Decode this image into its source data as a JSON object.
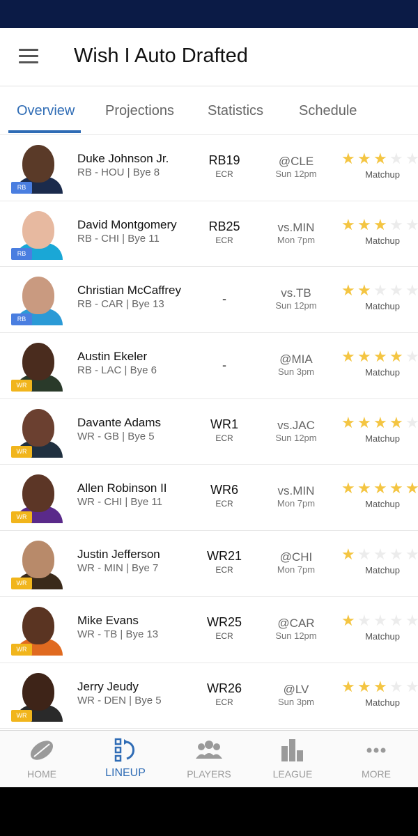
{
  "app": {
    "title": "Wish I Auto Drafted"
  },
  "tabs": [
    {
      "label": "Overview"
    },
    {
      "label": "Projections"
    },
    {
      "label": "Statistics"
    },
    {
      "label": "Schedule"
    }
  ],
  "colors": {
    "accent": "#2f6cb5",
    "rb_badge": "#4a7ee0",
    "wr_badge": "#f1b51c",
    "star": "#f4c542",
    "status_bar": "#0b1b46"
  },
  "players": [
    {
      "name": "Duke Johnson Jr.",
      "info": "RB - HOU | Bye 8",
      "badge": "RB",
      "rank": "RB19",
      "rank_label": "ECR",
      "opponent": "@CLE",
      "time": "Sun 12pm",
      "stars": 3,
      "matchup_label": "Matchup",
      "skin": "#5a3a28",
      "jersey": "#1b2b4c"
    },
    {
      "name": "David Montgomery",
      "info": "RB - CHI | Bye 11",
      "badge": "RB",
      "rank": "RB25",
      "rank_label": "ECR",
      "opponent": "vs.MIN",
      "time": "Mon 7pm",
      "stars": 3,
      "matchup_label": "Matchup",
      "skin": "#e7b9a0",
      "jersey": "#1aa7d6"
    },
    {
      "name": "Christian McCaffrey",
      "info": "RB - CAR | Bye 13",
      "badge": "RB",
      "rank": "-",
      "rank_label": "",
      "opponent": "vs.TB",
      "time": "Sun 12pm",
      "stars": 2,
      "matchup_label": "Matchup",
      "skin": "#c99a80",
      "jersey": "#2b9ad6"
    },
    {
      "name": "Austin Ekeler",
      "info": "RB - LAC | Bye 6",
      "badge": "WR",
      "rank": "-",
      "rank_label": "",
      "opponent": "@MIA",
      "time": "Sun 3pm",
      "stars": 4,
      "matchup_label": "Matchup",
      "skin": "#4a2c1e",
      "jersey": "#2a3a2a"
    },
    {
      "name": "Davante Adams",
      "info": "WR - GB | Bye 5",
      "badge": "WR",
      "rank": "WR1",
      "rank_label": "ECR",
      "opponent": "vs.JAC",
      "time": "Sun 12pm",
      "stars": 4,
      "matchup_label": "Matchup",
      "skin": "#6b4030",
      "jersey": "#203040"
    },
    {
      "name": "Allen Robinson II",
      "info": "WR - CHI | Bye 11",
      "badge": "WR",
      "rank": "WR6",
      "rank_label": "ECR",
      "opponent": "vs.MIN",
      "time": "Mon 7pm",
      "stars": 5,
      "matchup_label": "Matchup",
      "skin": "#5c3626",
      "jersey": "#5a2a8a"
    },
    {
      "name": "Justin Jefferson",
      "info": "WR - MIN | Bye 7",
      "badge": "WR",
      "rank": "WR21",
      "rank_label": "ECR",
      "opponent": "@CHI",
      "time": "Mon 7pm",
      "stars": 1,
      "matchup_label": "Matchup",
      "skin": "#b88a6a",
      "jersey": "#3a2a1a"
    },
    {
      "name": "Mike Evans",
      "info": "WR - TB | Bye 13",
      "badge": "WR",
      "rank": "WR25",
      "rank_label": "ECR",
      "opponent": "@CAR",
      "time": "Sun 12pm",
      "stars": 1,
      "matchup_label": "Matchup",
      "skin": "#5a3422",
      "jersey": "#e06a20"
    },
    {
      "name": "Jerry Jeudy",
      "info": "WR - DEN | Bye 5",
      "badge": "WR",
      "rank": "WR26",
      "rank_label": "ECR",
      "opponent": "@LV",
      "time": "Sun 3pm",
      "stars": 3,
      "matchup_label": "Matchup",
      "skin": "#3e2418",
      "jersey": "#2a2a2a"
    }
  ],
  "bottom_nav": [
    {
      "label": "HOME",
      "icon": "football-icon"
    },
    {
      "label": "LINEUP",
      "icon": "lineup-icon",
      "active": true
    },
    {
      "label": "PLAYERS",
      "icon": "players-icon"
    },
    {
      "label": "LEAGUE",
      "icon": "bar-chart-icon"
    },
    {
      "label": "MORE",
      "icon": "more-dots-icon"
    }
  ]
}
